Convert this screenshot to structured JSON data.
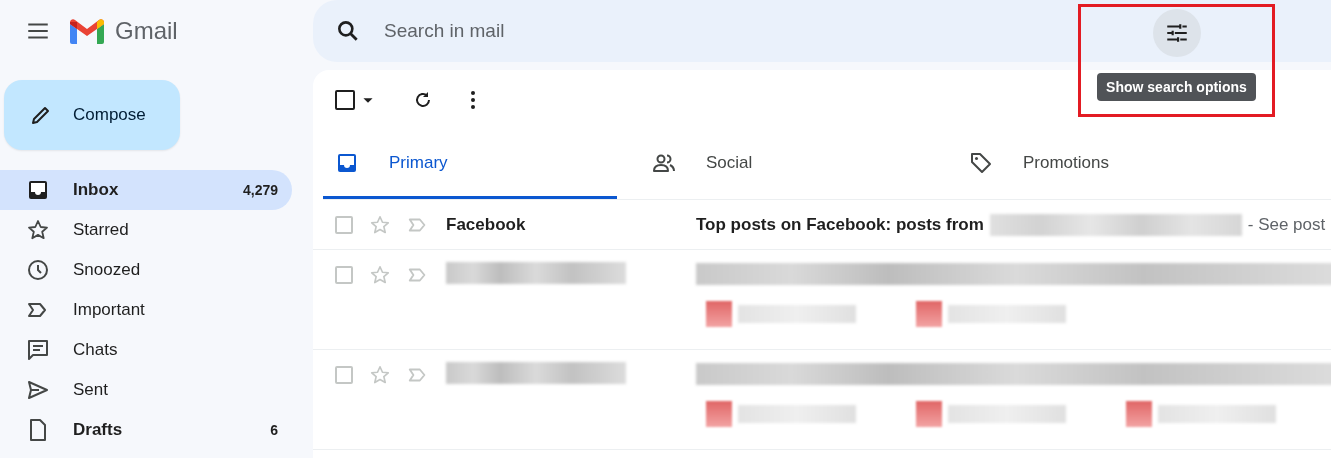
{
  "app": {
    "name": "Gmail"
  },
  "compose": {
    "label": "Compose"
  },
  "sidebar": {
    "items": [
      {
        "label": "Inbox",
        "count": "4,279",
        "selected": true,
        "bold": true
      },
      {
        "label": "Starred",
        "selected": false,
        "bold": false
      },
      {
        "label": "Snoozed",
        "selected": false,
        "bold": false
      },
      {
        "label": "Important",
        "selected": false,
        "bold": false
      },
      {
        "label": "Chats",
        "selected": false,
        "bold": false
      },
      {
        "label": "Sent",
        "selected": false,
        "bold": false
      },
      {
        "label": "Drafts",
        "count": "6",
        "selected": false,
        "bold": true
      }
    ]
  },
  "search": {
    "placeholder": "Search in mail",
    "tooltip": "Show search options",
    "highlighted": true
  },
  "toolbar": {
    "select_all_checked": false
  },
  "tabs": [
    {
      "label": "Primary",
      "selected": true
    },
    {
      "label": "Social",
      "selected": false
    },
    {
      "label": "Promotions",
      "selected": false
    }
  ],
  "messages": [
    {
      "kind": "message",
      "sender": "Facebook",
      "subject": "Top posts on Facebook: posts from",
      "snippet": "- See post",
      "unread": true,
      "checked": false,
      "starred": false
    },
    {
      "kind": "redacted",
      "checked": false,
      "starred": false,
      "chips": [
        {
          "kind": "attachment"
        },
        {
          "kind": "attachment"
        }
      ]
    },
    {
      "kind": "redacted",
      "checked": false,
      "starred": false,
      "chips": [
        {
          "kind": "attachment"
        },
        {
          "kind": "attachment"
        },
        {
          "kind": "attachment"
        }
      ]
    }
  ]
}
